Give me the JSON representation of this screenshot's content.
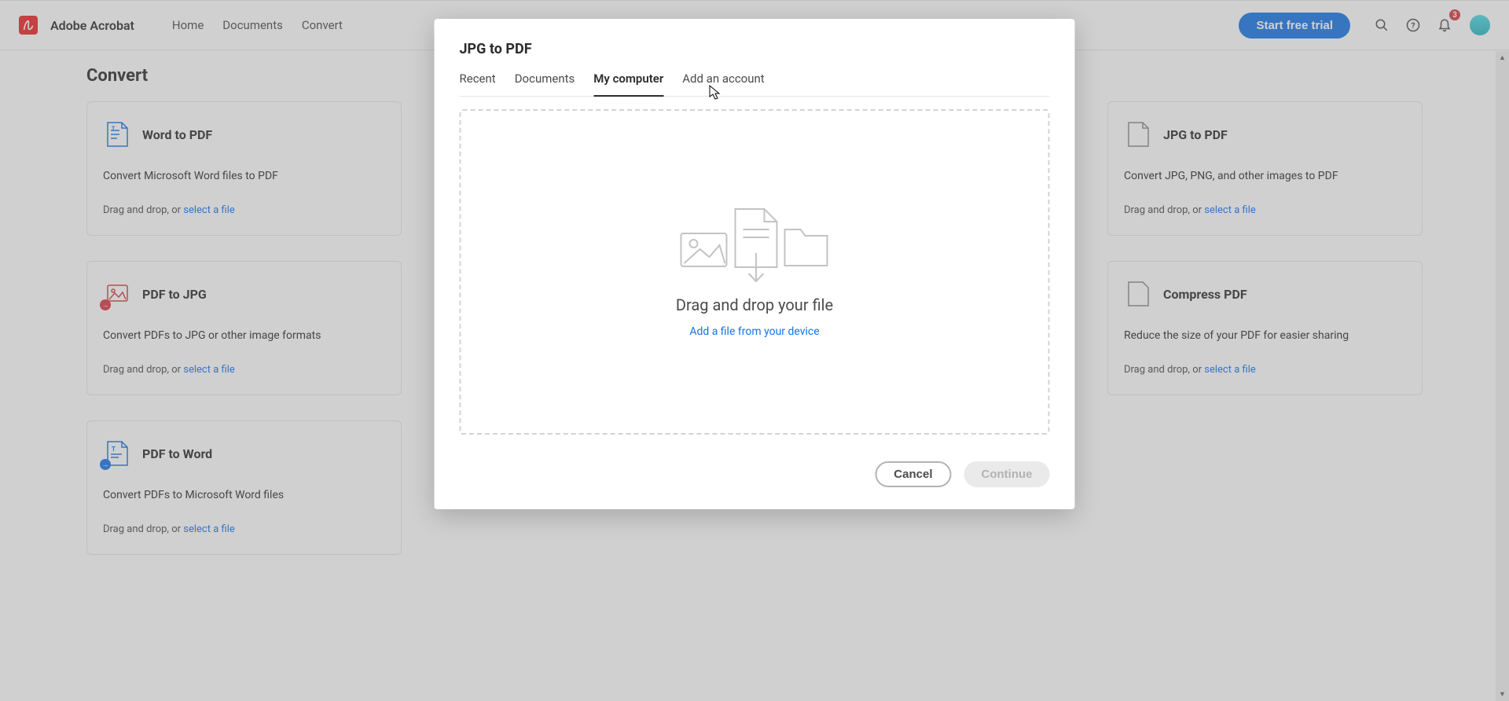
{
  "app": {
    "name": "Adobe Acrobat"
  },
  "nav": {
    "items": [
      "Home",
      "Documents",
      "Convert"
    ],
    "trial_btn": "Start free trial",
    "notif_count": "3"
  },
  "page": {
    "title": "Convert"
  },
  "cards": {
    "word_to_pdf": {
      "title": "Word to PDF",
      "desc": "Convert Microsoft Word files to PDF"
    },
    "jpg_to_pdf": {
      "title": "JPG to PDF",
      "desc": "Convert JPG, PNG, and other images to PDF"
    },
    "pdf_to_jpg": {
      "title": "PDF to JPG",
      "desc": "Convert PDFs to JPG or other image formats"
    },
    "compress": {
      "title": "Compress PDF",
      "desc": "Reduce the size of your PDF for easier sharing"
    },
    "pdf_to_word": {
      "title": "PDF to Word",
      "desc": "Convert PDFs to Microsoft Word files"
    },
    "foot_prefix": "Drag and drop, or ",
    "foot_link": "select a file"
  },
  "modal": {
    "title": "JPG to PDF",
    "tabs": {
      "recent": "Recent",
      "documents": "Documents",
      "my_computer": "My computer",
      "add_account": "Add an account"
    },
    "drop": {
      "headline": "Drag and drop your file",
      "sub": "Add a file from your device"
    },
    "actions": {
      "cancel": "Cancel",
      "continue": "Continue"
    }
  }
}
